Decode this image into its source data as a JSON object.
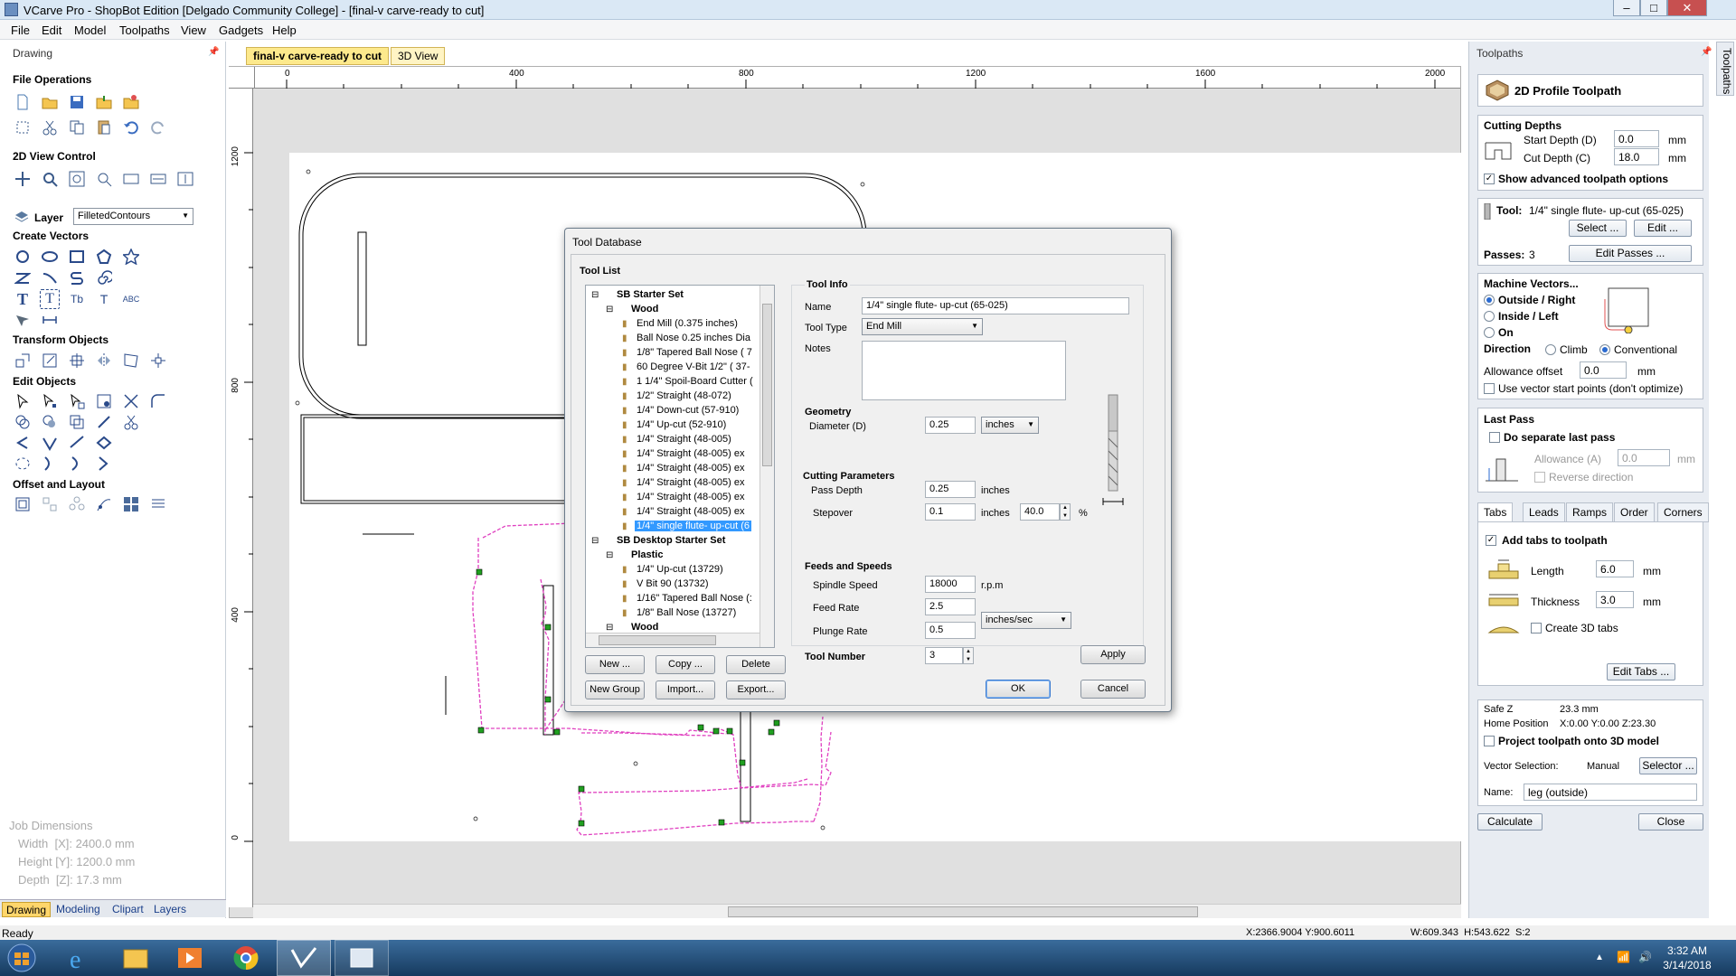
{
  "app": {
    "title": "VCarve Pro - ShopBot Edition [Delgado Community College] - [final-v carve-ready to cut]"
  },
  "menu": [
    "File",
    "Edit",
    "Model",
    "Toolpaths",
    "View",
    "Gadgets",
    "Help"
  ],
  "left": {
    "panel_title": "Drawing",
    "file_ops": "File Operations",
    "view_control": "2D View Control",
    "layer_label": "Layer",
    "layer_value": "FilletedContours",
    "create_vectors": "Create Vectors",
    "transform": "Transform Objects",
    "edit_objects": "Edit Objects",
    "offset_layout": "Offset and Layout",
    "job_dims_title": "Job Dimensions",
    "job_width": "Width  [X]: 2400.0 mm",
    "job_height": "Height [Y]: 1200.0 mm",
    "job_depth": "Depth  [Z]: 17.3 mm",
    "tabs": [
      "Drawing",
      "Modeling",
      "Clipart",
      "Layers"
    ]
  },
  "doc_tabs": [
    "final-v carve-ready to cut",
    "3D View"
  ],
  "ruler": {
    "h": [
      "0",
      "400",
      "800",
      "1200",
      "1600",
      "2000"
    ],
    "v": [
      "1200",
      "800",
      "400",
      "0"
    ]
  },
  "dialog": {
    "title": "Tool Database",
    "tool_list_label": "Tool List",
    "tree": [
      {
        "level": 0,
        "label": "SB Starter Set",
        "bold": true
      },
      {
        "level": 1,
        "label": "Wood",
        "bold": true
      },
      {
        "level": 2,
        "label": "End Mill (0.375 inches)"
      },
      {
        "level": 2,
        "label": "Ball Nose 0.25 inches Dia"
      },
      {
        "level": 2,
        "label": "1/8\" Tapered Ball Nose ( 7"
      },
      {
        "level": 2,
        "label": "60 Degree V-Bit 1/2\"  ( 37-"
      },
      {
        "level": 2,
        "label": "1 1/4\" Spoil-Board Cutter ("
      },
      {
        "level": 2,
        "label": "1/2\" Straight  (48-072)"
      },
      {
        "level": 2,
        "label": "1/4\"  Down-cut (57-910)"
      },
      {
        "level": 2,
        "label": "1/4\" Up-cut (52-910)"
      },
      {
        "level": 2,
        "label": "1/4\" Straight  (48-005)"
      },
      {
        "level": 2,
        "label": "1/4\" Straight  (48-005) ex"
      },
      {
        "level": 2,
        "label": "1/4\" Straight  (48-005) ex"
      },
      {
        "level": 2,
        "label": "1/4\" Straight  (48-005) ex"
      },
      {
        "level": 2,
        "label": "1/4\" Straight  (48-005) ex"
      },
      {
        "level": 2,
        "label": "1/4\" Straight  (48-005) ex"
      },
      {
        "level": 2,
        "label": "1/4\" single flute- up-cut (6",
        "selected": true
      },
      {
        "level": 0,
        "label": "SB Desktop Starter Set",
        "bold": true
      },
      {
        "level": 1,
        "label": "Plastic",
        "bold": true
      },
      {
        "level": 2,
        "label": "1/4\" Up-cut (13729)"
      },
      {
        "level": 2,
        "label": "V Bit 90 (13732)"
      },
      {
        "level": 2,
        "label": "1/16\" Tapered Ball Nose (:"
      },
      {
        "level": 2,
        "label": "1/8\" Ball Nose (13727)"
      },
      {
        "level": 1,
        "label": "Wood",
        "bold": true
      }
    ],
    "buttons_row1": [
      "New ...",
      "Copy ...",
      "Delete"
    ],
    "buttons_row2": [
      "New Group",
      "Import...",
      "Export..."
    ],
    "tool_info": "Tool Info",
    "name_label": "Name",
    "name_value": "1/4\" single flute- up-cut (65-025)",
    "tool_type_label": "Tool Type",
    "tool_type_value": "End Mill",
    "notes_label": "Notes",
    "geometry": "Geometry",
    "diameter_label": "Diameter (D)",
    "diameter_value": "0.25",
    "diameter_units": "inches",
    "cutting_params": "Cutting Parameters",
    "pass_depth_label": "Pass Depth",
    "pass_depth_value": "0.25",
    "pass_depth_units": "inches",
    "stepover_label": "Stepover",
    "stepover_value": "0.1",
    "stepover_units": "inches",
    "stepover_pct": "40.0",
    "pct": "%",
    "feeds_speeds": "Feeds and Speeds",
    "spindle_label": "Spindle Speed",
    "spindle_value": "18000",
    "spindle_units": "r.p.m",
    "feed_label": "Feed Rate",
    "feed_value": "2.5",
    "plunge_label": "Plunge Rate",
    "plunge_value": "0.5",
    "rate_units": "inches/sec",
    "tool_number_label": "Tool Number",
    "tool_number_value": "3",
    "apply": "Apply",
    "ok": "OK",
    "cancel": "Cancel"
  },
  "right": {
    "panel_title": "Toolpaths",
    "vtab": "Toolpaths",
    "header": "2D Profile Toolpath",
    "cutting_depths": "Cutting Depths",
    "start_depth_label": "Start Depth (D)",
    "start_depth_value": "0.0",
    "cut_depth_label": "Cut Depth (C)",
    "cut_depth_value": "18.0",
    "mm": "mm",
    "show_adv": "Show advanced toolpath options",
    "tool_label": "Tool:",
    "tool_value": "1/4\" single flute- up-cut (65-025)",
    "select_btn": "Select ...",
    "edit_btn": "Edit ...",
    "passes_label": "Passes:",
    "passes_value": "3",
    "edit_passes": "Edit Passes ...",
    "machine_vectors": "Machine Vectors...",
    "outside": "Outside / Right",
    "inside": "Inside / Left",
    "on": "On",
    "direction": "Direction",
    "climb": "Climb",
    "conventional": "Conventional",
    "allowance_label": "Allowance offset",
    "allowance_value": "0.0",
    "use_vector_start": "Use vector start points (don't optimize)",
    "last_pass": "Last Pass",
    "separate_last": "Do separate last pass",
    "allowance_a": "Allowance (A)",
    "allowance_a_value": "0.0",
    "reverse_dir": "Reverse direction",
    "tabs": [
      "Tabs",
      "Leads",
      "Ramps",
      "Order",
      "Corners"
    ],
    "add_tabs": "Add tabs to toolpath",
    "length_label": "Length",
    "length_value": "6.0",
    "thickness_label": "Thickness",
    "thickness_value": "3.0",
    "create_3d_tabs": "Create 3D tabs",
    "edit_tabs": "Edit Tabs ...",
    "safe_z": "Safe Z",
    "safe_z_value": "23.3 mm",
    "home_pos": "Home Position",
    "home_pos_value": "X:0.00 Y:0.00 Z:23.30",
    "project": "Project toolpath onto 3D model",
    "vector_sel": "Vector Selection:",
    "vector_sel_value": "Manual",
    "selector_btn": "Selector ...",
    "name_label": "Name:",
    "name_value": "leg (outside)",
    "calculate": "Calculate",
    "close": "Close"
  },
  "status": {
    "ready": "Ready",
    "coords": "X:2366.9004 Y:900.6011",
    "size": "W:609.343  H:543.622  S:2"
  },
  "taskbar": {
    "time": "3:32 AM",
    "date": "3/14/2018"
  },
  "colors": {
    "toolpath": "#e040c0",
    "selection": "#3399ff",
    "accent": "#ffd66b"
  }
}
